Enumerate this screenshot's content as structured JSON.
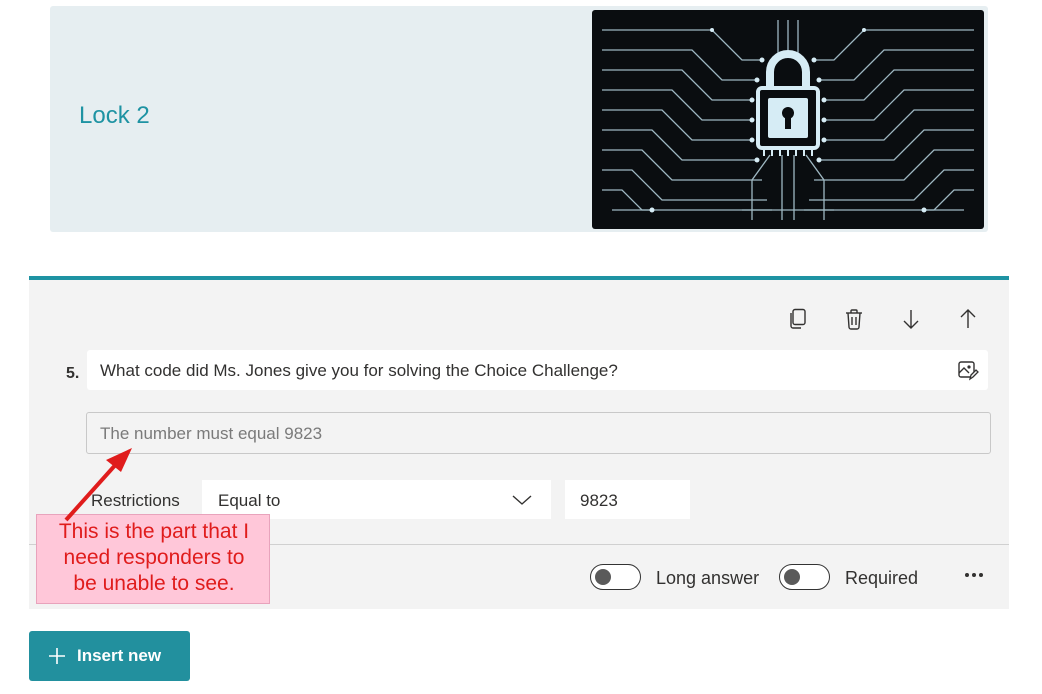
{
  "section": {
    "title": "Lock 2",
    "image_icon": "circuit-lock-image"
  },
  "toolbar": {
    "copy_icon": "copy-icon",
    "delete_icon": "trash-icon",
    "move_down_icon": "arrow-down-icon",
    "move_up_icon": "arrow-up-icon"
  },
  "question": {
    "number": "5.",
    "title": "What code did Ms. Jones give you for solving the Choice Challenge?",
    "media_icon": "image-edit-icon",
    "answer_placeholder": "The number must equal 9823",
    "restrictions_label": "Restrictions",
    "restriction_type": "Equal to",
    "restriction_value": "9823"
  },
  "footer": {
    "long_answer_label": "Long answer",
    "long_answer_on": false,
    "required_label": "Required",
    "required_on": false,
    "more_icon": "more-horizontal-icon"
  },
  "insert_button": {
    "label": "Insert new",
    "icon": "plus-icon"
  },
  "annotation": {
    "text": "This is the part that I\nneed responders to\nbe unable to see.",
    "color": "#e01c1c",
    "background": "#ffc7d9"
  },
  "colors": {
    "accent": "#1e93a3",
    "button": "#22909e"
  }
}
